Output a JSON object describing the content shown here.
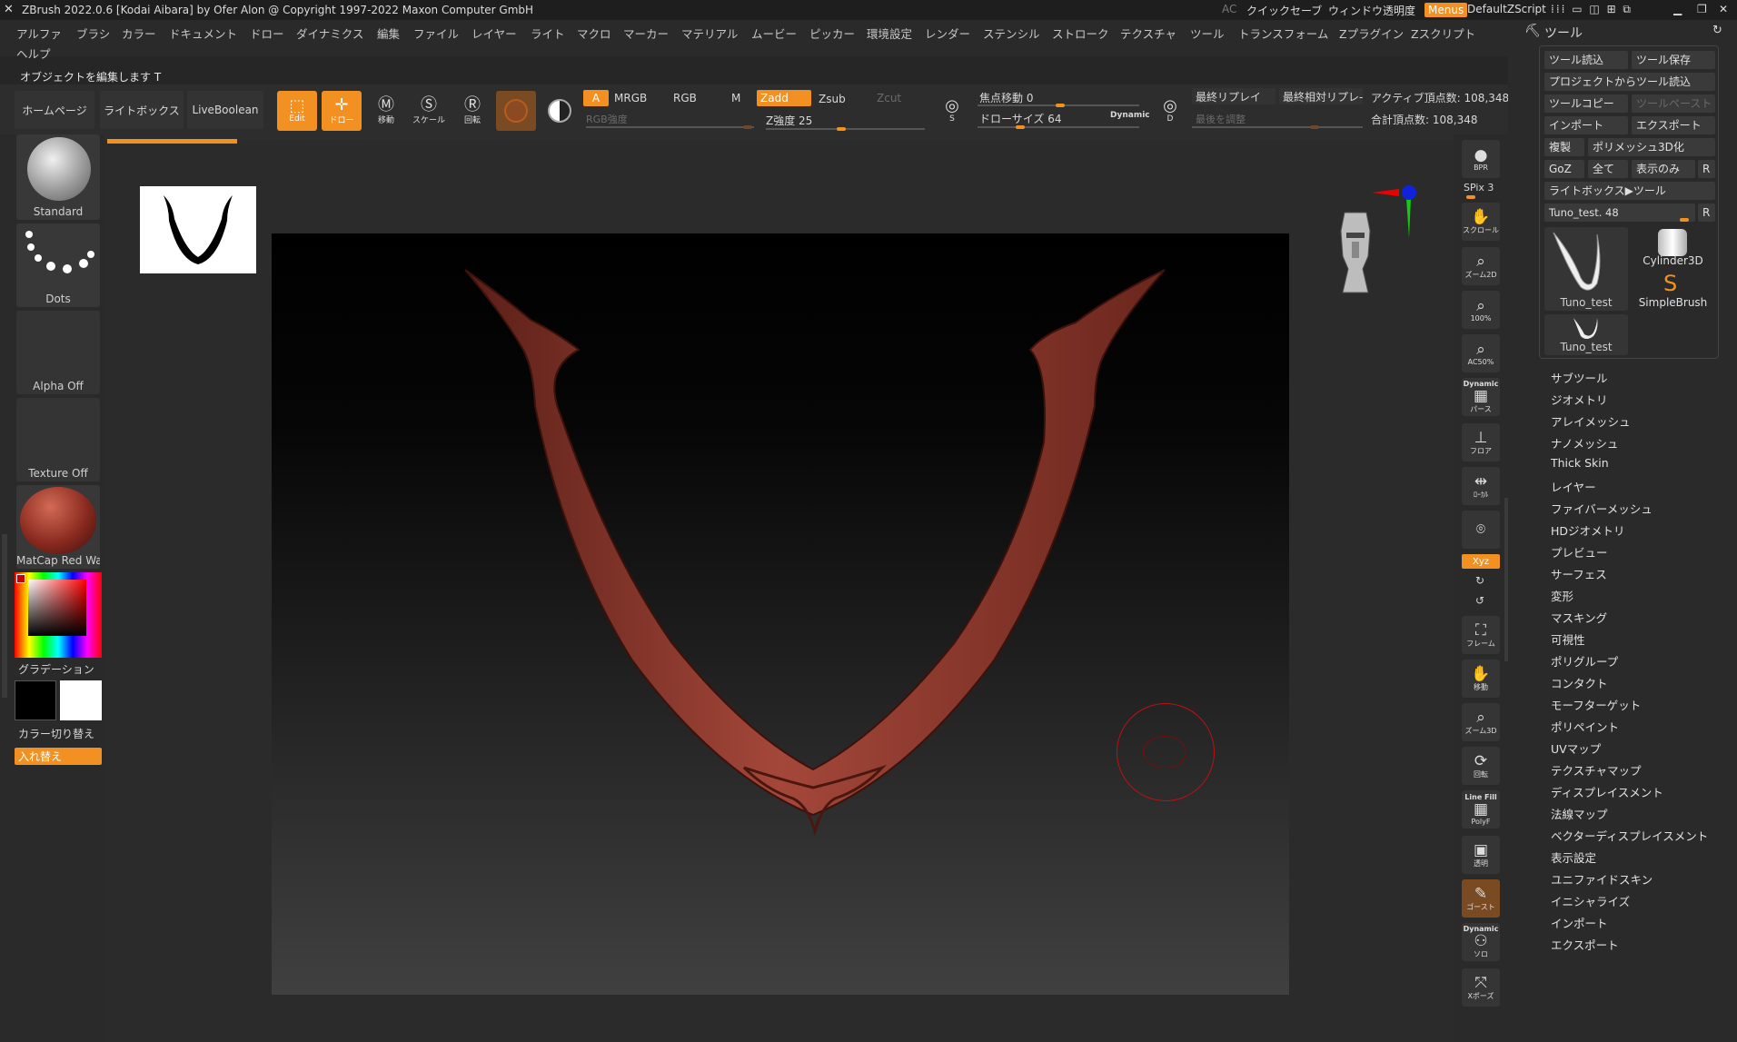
{
  "titlebar": {
    "title": "ZBrush 2022.0.6 [Kodai Aibara] by Ofer Alon @ Copyright 1997-2022 Maxon Computer GmbH",
    "ac": "AC",
    "quicksave": "クイックセーブ",
    "window_transparency": "ウィンドウ透明度",
    "menus": "Menus",
    "default_script": "DefaultZScript"
  },
  "menubar": {
    "items": [
      "アルファ",
      "ブラシ",
      "カラー",
      "ドキュメント",
      "ドロー",
      "ダイナミクス",
      "編集",
      "ファイル",
      "レイヤー",
      "ライト",
      "マクロ",
      "マーカー",
      "マテリアル",
      "ムービー",
      "ピッカー",
      "環境設定",
      "レンダー",
      "ステンシル",
      "ストローク",
      "テクスチャ",
      "ツール",
      "トランスフォーム",
      "Zプラグイン",
      "Zスクリプト"
    ],
    "help": "ヘルプ"
  },
  "status": "オブジェクトを編集します T",
  "shelf": {
    "home": "ホームページ",
    "lightbox": "ライトボックス",
    "liveboolean": "LiveBoolean",
    "edit": "Edit",
    "draw": "ドロー",
    "move": "移動",
    "scale": "スケール",
    "rotate": "回転",
    "a": "A",
    "mrgb": "MRGB",
    "rgb": "RGB",
    "m": "M",
    "zadd": "Zadd",
    "zsub": "Zsub",
    "zcut": "Zcut",
    "rgb_intensity": "RGB強度",
    "z_intensity": "Z強度 25",
    "focal_shift": "焦点移動 0",
    "draw_size": "ドローサイズ 64",
    "dynamic": "Dynamic",
    "s": "S",
    "d": "D",
    "last_replay": "最終リプレイ",
    "last_rel_replay": "最終相対リプレ-",
    "adjust_last": "最後を調整",
    "active_points": "アクティブ頂点数: 108,348",
    "total_points": "合計頂点数: 108,348"
  },
  "leftpanel": {
    "brush": "Standard",
    "stroke": "Dots",
    "alpha": "Alpha Off",
    "texture": "Texture Off",
    "material": "MatCap Red Wax",
    "gradient": "グラデーション",
    "switch_color": "カラー切り替え",
    "swap": "入れ替え",
    "colors": {
      "main": "#000000",
      "secondary": "#ffffff",
      "accent": "#f29122"
    }
  },
  "rightstrip": {
    "bpr": "BPR",
    "spix": "SPix 3",
    "scroll": "スクロール",
    "zoom2d": "ズーム2D",
    "hundred": "100%",
    "ac50": "AC50%",
    "dynamic": "Dynamic",
    "persp": "パース",
    "floor": "フロア",
    "local": "ﾛｰｶﾙ",
    "xyz": "Xyz",
    "frame": "フレーム",
    "move": "移動",
    "zoom3d": "ズーム3D",
    "rotate": "回転",
    "linefill": "Line Fill",
    "polyf": "PolyF",
    "transp": "透明",
    "ghost": "ゴースト",
    "solo": "ソロ",
    "xpose": "Xポーズ"
  },
  "toolpalette": {
    "header": "ツール",
    "load": "ツール読込",
    "save": "ツール保存",
    "from_project": "プロジェクトからツール読込",
    "copy": "ツールコピー",
    "paste": "ツールペースト",
    "import": "インポート",
    "export": "エクスポート",
    "clone": "複製",
    "make_polymesh": "ポリメッシュ3D化",
    "goz": "GoZ",
    "all": "全て",
    "visible": "表示のみ",
    "r": "R",
    "lightbox_tools": "ライトボックス▶ツール",
    "current_tool": "Tuno_test. 48",
    "thumbs": [
      "Tuno_test",
      "Cylinder3D",
      "SimpleBrush",
      "Tuno_test"
    ],
    "sections": [
      "サブツール",
      "ジオメトリ",
      "アレイメッシュ",
      "ナノメッシュ",
      "Thick Skin",
      "レイヤー",
      "ファイバーメッシュ",
      "HDジオメトリ",
      "プレビュー",
      "サーフェス",
      "変形",
      "マスキング",
      "可視性",
      "ポリグループ",
      "コンタクト",
      "モーフターゲット",
      "ポリペイント",
      "UVマップ",
      "テクスチャマップ",
      "ディスプレイスメント",
      "法線マップ",
      "ベクターディスプレイスメント",
      "表示設定",
      "ユニファイドスキン",
      "イニシャライズ",
      "インポート",
      "エクスポート"
    ]
  },
  "colors": {
    "accent": "#f29122",
    "model": "#8a3a30",
    "brush_ring": "#c01010"
  }
}
